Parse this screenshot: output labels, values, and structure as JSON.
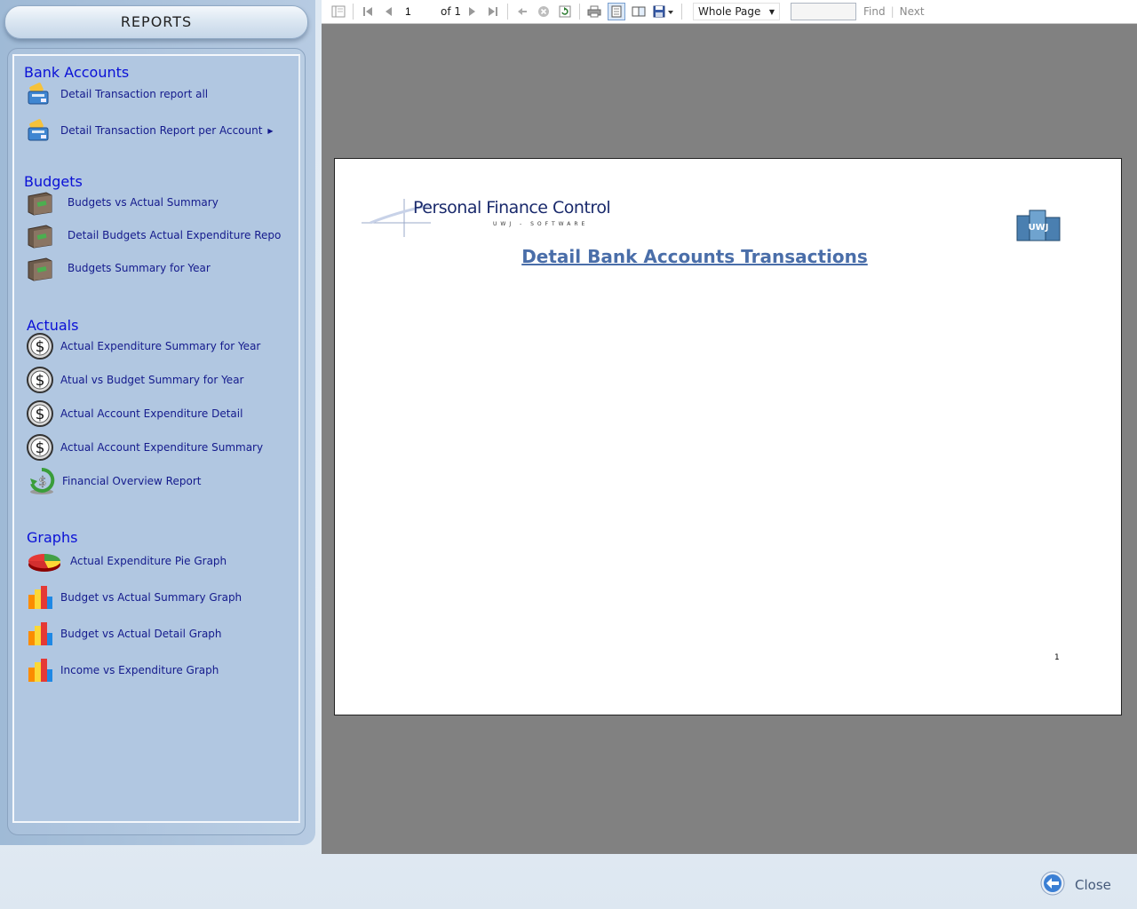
{
  "sidebar": {
    "header": "REPORTS",
    "sections": [
      {
        "title": "Bank Accounts",
        "items": [
          {
            "label": "Detail Transaction report all",
            "icon": "wallet-card-icon"
          },
          {
            "label": "Detail Transaction Report per Account",
            "icon": "wallet-card-icon",
            "submenu": true
          }
        ]
      },
      {
        "title": "Budgets",
        "items": [
          {
            "label": "Budgets vs Actual Summary",
            "icon": "safe-box-icon"
          },
          {
            "label": "Detail Budgets Actual Expenditure Repo",
            "icon": "safe-box-icon"
          },
          {
            "label": "Budgets Summary for Year",
            "icon": "safe-box-icon"
          }
        ]
      },
      {
        "title": "Actuals",
        "items": [
          {
            "label": "Actual Expenditure Summary for Year",
            "icon": "dollar-coin-icon"
          },
          {
            "label": "Atual vs Budget Summary for Year",
            "icon": "dollar-coin-icon"
          },
          {
            "label": "Actual Account Expenditure Detail",
            "icon": "dollar-coin-icon"
          },
          {
            "label": "Actual Account Expenditure Summary",
            "icon": "dollar-coin-icon"
          },
          {
            "label": "Financial Overview Report",
            "icon": "dollar-cycle-icon"
          }
        ]
      },
      {
        "title": "Graphs",
        "items": [
          {
            "label": "Actual Expenditure Pie Graph",
            "icon": "pie-chart-icon"
          },
          {
            "label": "Budget vs Actual Summary Graph",
            "icon": "bar-chart-icon"
          },
          {
            "label": "Budget vs Actual Detail Graph",
            "icon": "bar-chart-icon"
          },
          {
            "label": "Income vs Expenditure Graph",
            "icon": "bar-chart-icon"
          }
        ]
      }
    ]
  },
  "toolbar": {
    "page_current": "1",
    "page_of": "of 1",
    "zoom": "Whole Page",
    "find_value": "",
    "find_label": "Find",
    "next_label": "Next"
  },
  "report": {
    "logo_text": "Personal Finance Control",
    "logo_sub": "UWJ - SOFTWARE",
    "company_badge": "UWJ",
    "title": "Detail Bank Accounts Transactions",
    "page_number": "1"
  },
  "footer": {
    "close_label": "Close"
  }
}
